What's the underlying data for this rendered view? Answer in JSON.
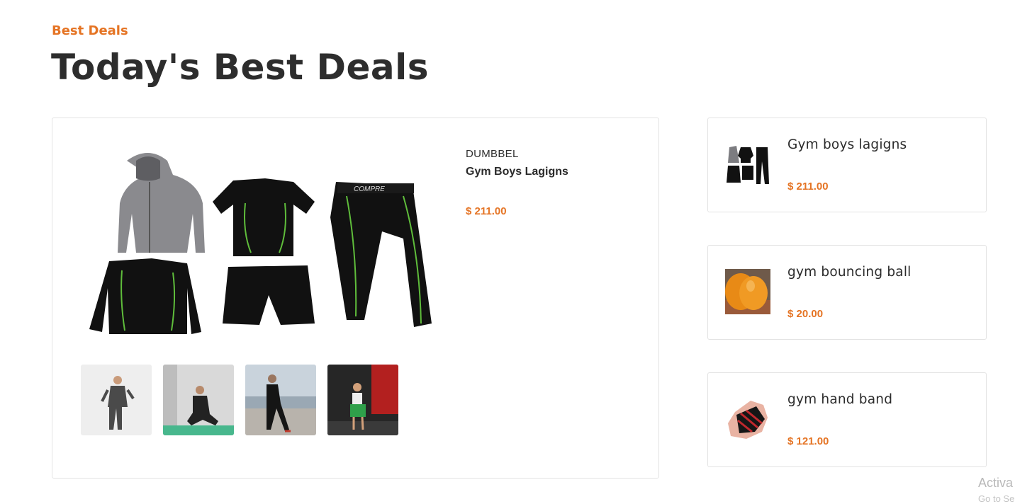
{
  "section": {
    "eyebrow": "Best Deals",
    "title": "Today's Best Deals"
  },
  "featured": {
    "category": "DUMBBEL",
    "name": "Gym Boys Lagigns",
    "price": "$ 211.00",
    "image_icon": "gym-clothing-set-image",
    "thumbnails": [
      {
        "name": "thumbnail-1",
        "icon": "man-in-gray-sportswear-photo"
      },
      {
        "name": "thumbnail-2",
        "icon": "man-sitting-on-mat-photo"
      },
      {
        "name": "thumbnail-3",
        "icon": "man-stretching-outdoors-photo"
      },
      {
        "name": "thumbnail-4",
        "icon": "woman-in-gym-photo"
      }
    ]
  },
  "side_deals": [
    {
      "name": "Gym boys lagigns",
      "price": "$ 211.00",
      "icon": "gym-clothing-set-thumb"
    },
    {
      "name": "gym bouncing ball",
      "price": "$ 20.00",
      "icon": "orange-ball-thumb"
    },
    {
      "name": "gym hand band",
      "price": "$ 121.00",
      "icon": "hand-wrap-thumb"
    }
  ],
  "watermark": {
    "line1": "Activa",
    "line2": "Go to Se"
  },
  "colors": {
    "accent": "#e57424",
    "text": "#2b2b2b",
    "border": "#e3e3e3"
  }
}
